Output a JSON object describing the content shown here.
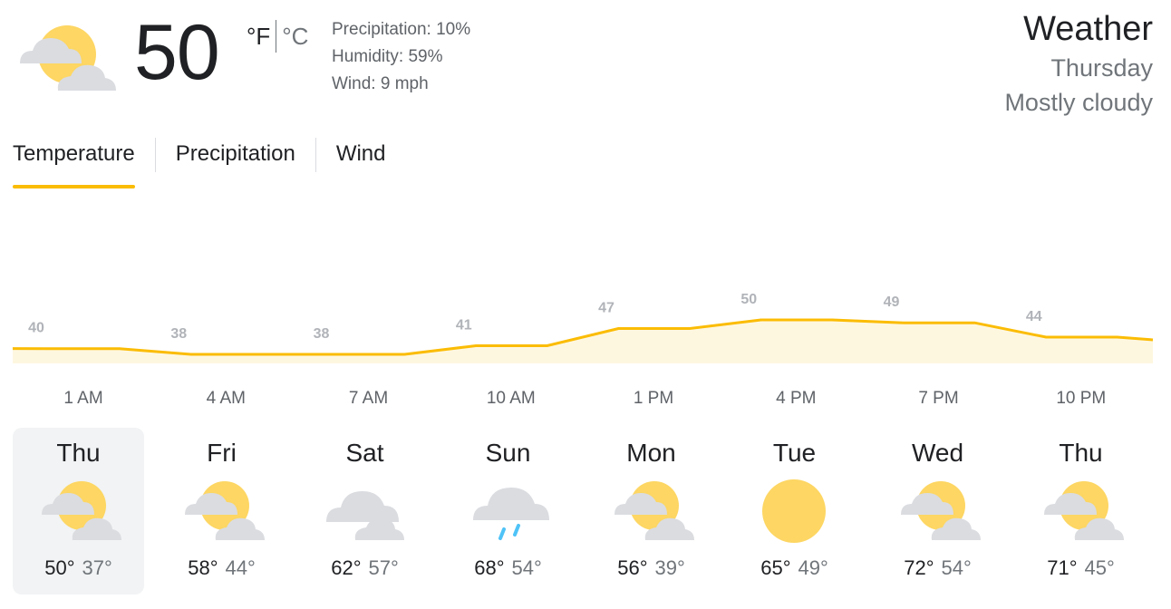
{
  "current": {
    "temperature": "50",
    "unit_f": "°F",
    "unit_c": "°C",
    "precipitation": "Precipitation: 10%",
    "humidity": "Humidity: 59%",
    "wind": "Wind: 9 mph",
    "icon": "partly-cloudy-icon"
  },
  "header": {
    "title": "Weather",
    "day": "Thursday",
    "condition": "Mostly cloudy"
  },
  "tabs": [
    {
      "label": "Temperature",
      "active": true
    },
    {
      "label": "Precipitation",
      "active": false
    },
    {
      "label": "Wind",
      "active": false
    }
  ],
  "chart_data": {
    "type": "area",
    "x": [
      "1 AM",
      "4 AM",
      "7 AM",
      "10 AM",
      "1 PM",
      "4 PM",
      "7 PM",
      "10 PM"
    ],
    "values": [
      40,
      38,
      38,
      41,
      47,
      50,
      49,
      44
    ],
    "line_color": "#fbbc04",
    "fill_color": "#fef7e0"
  },
  "days": [
    {
      "name": "Thu",
      "hi": "50°",
      "lo": "37°",
      "icon": "partly-cloudy-icon",
      "selected": true
    },
    {
      "name": "Fri",
      "hi": "58°",
      "lo": "44°",
      "icon": "partly-cloudy-icon",
      "selected": false
    },
    {
      "name": "Sat",
      "hi": "62°",
      "lo": "57°",
      "icon": "cloudy-icon",
      "selected": false
    },
    {
      "name": "Sun",
      "hi": "68°",
      "lo": "54°",
      "icon": "rain-icon",
      "selected": false
    },
    {
      "name": "Mon",
      "hi": "56°",
      "lo": "39°",
      "icon": "partly-cloudy-icon",
      "selected": false
    },
    {
      "name": "Tue",
      "hi": "65°",
      "lo": "49°",
      "icon": "sunny-icon",
      "selected": false
    },
    {
      "name": "Wed",
      "hi": "72°",
      "lo": "54°",
      "icon": "partly-cloudy-icon",
      "selected": false
    },
    {
      "name": "Thu",
      "hi": "71°",
      "lo": "45°",
      "icon": "partly-cloudy-icon",
      "selected": false
    }
  ]
}
